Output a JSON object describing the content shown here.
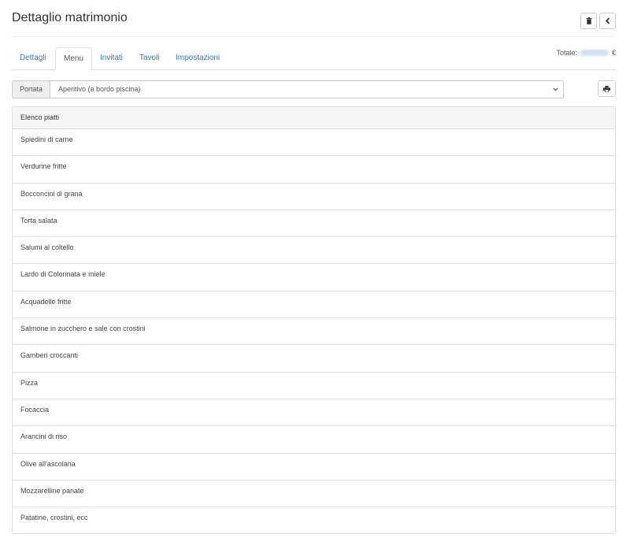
{
  "page": {
    "title": "Dettaglio matrimonio"
  },
  "header": {
    "delete_icon": "trash-icon",
    "back_icon": "chevron-left-icon"
  },
  "tabs": [
    {
      "label": "Dettagli",
      "active": false
    },
    {
      "label": "Menu",
      "active": true
    },
    {
      "label": "Invitati",
      "active": false
    },
    {
      "label": "Tavoli",
      "active": false
    },
    {
      "label": "Impostazioni",
      "active": false
    }
  ],
  "total": {
    "label": "Totale:",
    "currency": "€"
  },
  "course_select": {
    "addon_label": "Portata",
    "selected": "Aperitivo (a bordo piscina)"
  },
  "print_icon": "print-icon",
  "dishes": {
    "heading": "Elenco piatti",
    "items": [
      "Spiedini di carne",
      "Verdurine fritte",
      "Bocconcini di grana",
      "Torta salata",
      "Salumi al coltello",
      "Lardo di Colonnata e miele",
      "Acquadelle fritte",
      "Salmone in zucchero e sale con crostini",
      "Gamberi croccanti",
      "Pizza",
      "Focaccia",
      "Arancini di riso",
      "Olive all'ascolana",
      "Mozzarelline panate",
      "Patatine, crostini, ecc"
    ]
  },
  "colors": {
    "link": "#337ab7",
    "border": "#dddddd",
    "heading_bg": "#f5f5f5"
  }
}
